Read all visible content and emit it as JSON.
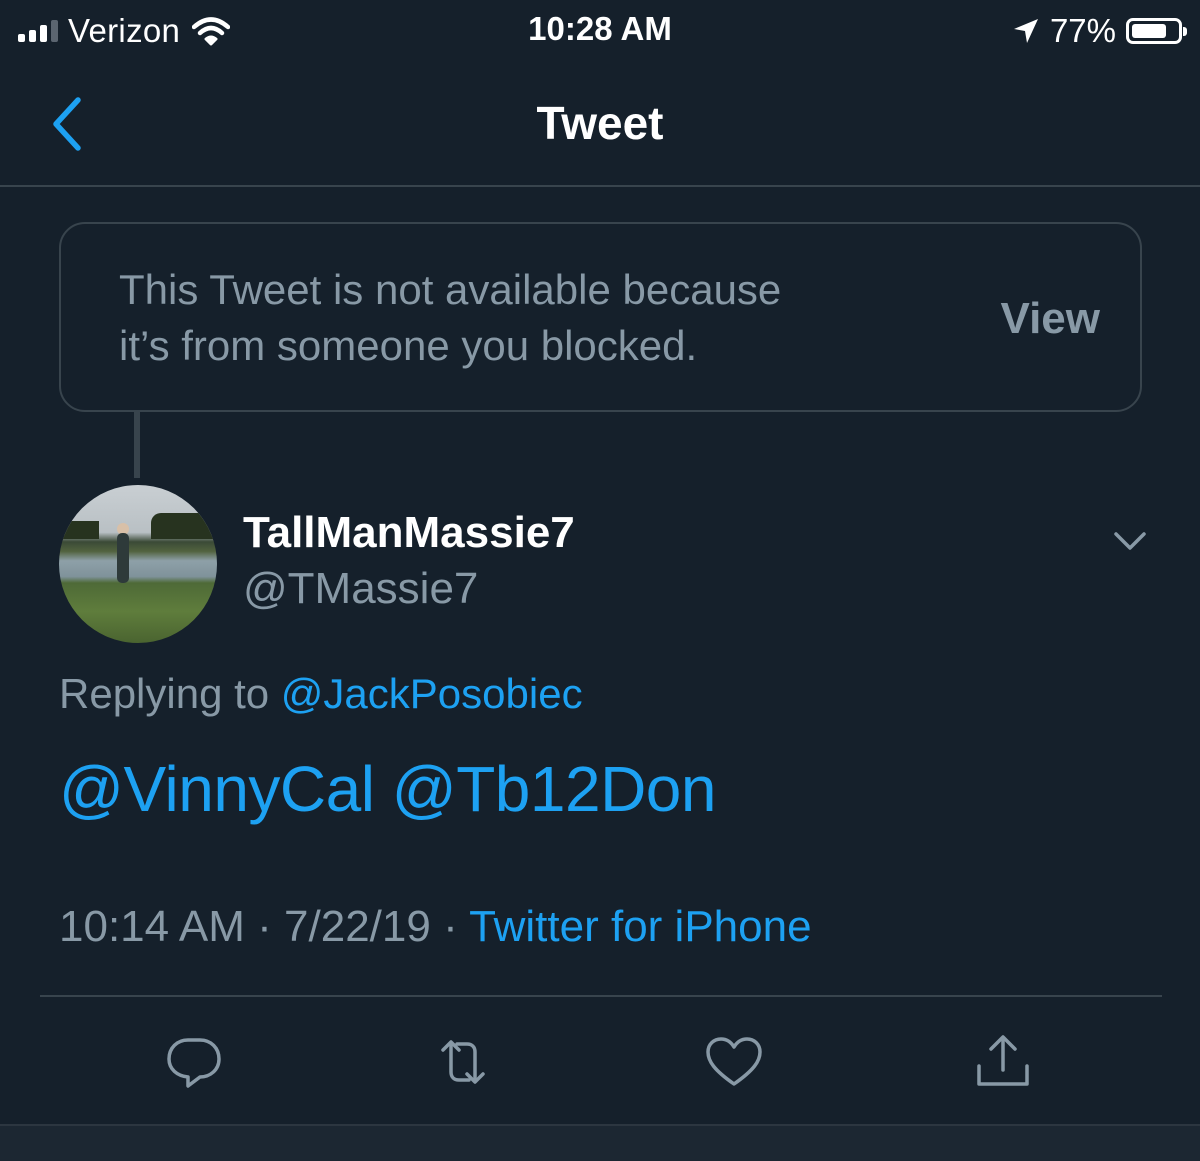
{
  "status_bar": {
    "carrier": "Verizon",
    "time": "10:28 AM",
    "battery_pct": "77%",
    "battery_level": 0.77,
    "icons": [
      "signal-bars-icon",
      "wifi-icon",
      "location-arrow-icon",
      "battery-icon"
    ]
  },
  "nav": {
    "title": "Tweet",
    "back_icon": "chevron-left-icon"
  },
  "unavailable": {
    "line1": "This Tweet is not available because",
    "line2": "it’s from someone you blocked.",
    "view_label": "View"
  },
  "tweet": {
    "display_name": "TallManMassie7",
    "handle": "@TMassie7",
    "replying_prefix": "Replying to",
    "replying_to": "@JackPosobiec",
    "mentions": [
      "@VinnyCal",
      "@Tb12Don"
    ],
    "time": "10:14 AM",
    "date": "7/22/19",
    "source": "Twitter for iPhone",
    "separator": "·"
  },
  "actions": {
    "icons": [
      "reply-icon",
      "retweet-icon",
      "like-icon",
      "share-icon"
    ]
  },
  "colors": {
    "background": "#15202b",
    "accent": "#1da1f2",
    "secondary_text": "#8899a6",
    "divider": "#38444d"
  }
}
